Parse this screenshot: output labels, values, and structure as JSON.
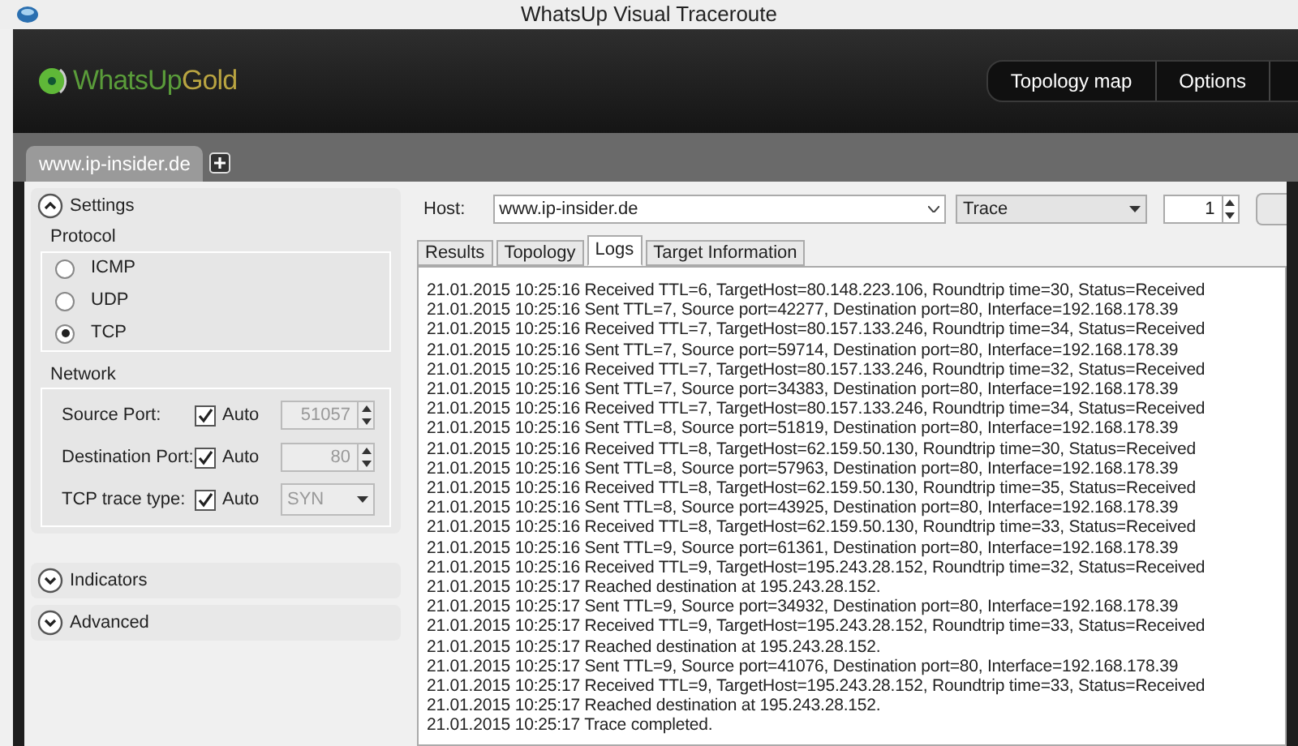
{
  "window": {
    "title": "WhatsUp Visual Traceroute"
  },
  "header": {
    "logo_first": "WhatsUp",
    "logo_second": "Gold",
    "nav": [
      {
        "label": "Topology map"
      },
      {
        "label": "Options"
      }
    ]
  },
  "document_tabs": [
    {
      "label": "www.ip-insider.de",
      "selected": true
    }
  ],
  "sidebar": {
    "sections": [
      {
        "title": "Settings",
        "expanded": true
      },
      {
        "title": "Indicators",
        "expanded": false
      },
      {
        "title": "Advanced",
        "expanded": false
      }
    ],
    "protocol": {
      "title": "Protocol",
      "options": [
        {
          "label": "ICMP",
          "selected": false
        },
        {
          "label": "UDP",
          "selected": false
        },
        {
          "label": "TCP",
          "selected": true
        }
      ]
    },
    "network": {
      "title": "Network",
      "rows": [
        {
          "label": "Source Port:",
          "auto_label": "Auto",
          "checked": true,
          "kind": "spinner",
          "value": "51057"
        },
        {
          "label": "Destination Port:",
          "auto_label": "Auto",
          "checked": true,
          "kind": "spinner",
          "value": "80"
        },
        {
          "label": "TCP trace type:",
          "auto_label": "Auto",
          "checked": true,
          "kind": "dropdown",
          "value": "SYN"
        }
      ]
    }
  },
  "toolbar": {
    "host_label": "Host:",
    "host": "www.ip-insider.de",
    "mode": "Trace",
    "count": "1"
  },
  "view_tabs": [
    {
      "label": "Results",
      "selected": false
    },
    {
      "label": "Topology",
      "selected": false
    },
    {
      "label": "Logs",
      "selected": true
    },
    {
      "label": "Target Information",
      "selected": false
    }
  ],
  "log": [
    "21.01.2015 10:25:16 Received TTL=6, TargetHost=80.148.223.106, Roundtrip time=30, Status=Received",
    "21.01.2015 10:25:16 Sent TTL=7, Source port=42277, Destination port=80, Interface=192.168.178.39",
    "21.01.2015 10:25:16 Received TTL=7, TargetHost=80.157.133.246, Roundtrip time=34, Status=Received",
    "21.01.2015 10:25:16 Sent TTL=7, Source port=59714, Destination port=80, Interface=192.168.178.39",
    "21.01.2015 10:25:16 Received TTL=7, TargetHost=80.157.133.246, Roundtrip time=32, Status=Received",
    "21.01.2015 10:25:16 Sent TTL=7, Source port=34383, Destination port=80, Interface=192.168.178.39",
    "21.01.2015 10:25:16 Received TTL=7, TargetHost=80.157.133.246, Roundtrip time=34, Status=Received",
    "21.01.2015 10:25:16 Sent TTL=8, Source port=51819, Destination port=80, Interface=192.168.178.39",
    "21.01.2015 10:25:16 Received TTL=8, TargetHost=62.159.50.130, Roundtrip time=30, Status=Received",
    "21.01.2015 10:25:16 Sent TTL=8, Source port=57963, Destination port=80, Interface=192.168.178.39",
    "21.01.2015 10:25:16 Received TTL=8, TargetHost=62.159.50.130, Roundtrip time=35, Status=Received",
    "21.01.2015 10:25:16 Sent TTL=8, Source port=43925, Destination port=80, Interface=192.168.178.39",
    "21.01.2015 10:25:16 Received TTL=8, TargetHost=62.159.50.130, Roundtrip time=33, Status=Received",
    "21.01.2015 10:25:16 Sent TTL=9, Source port=61361, Destination port=80, Interface=192.168.178.39",
    "21.01.2015 10:25:16 Received TTL=9, TargetHost=195.243.28.152, Roundtrip time=32, Status=Received",
    "21.01.2015 10:25:17 Reached destination at 195.243.28.152.",
    "21.01.2015 10:25:17 Sent TTL=9, Source port=34932, Destination port=80, Interface=192.168.178.39",
    "21.01.2015 10:25:17 Received TTL=9, TargetHost=195.243.28.152, Roundtrip time=33, Status=Received",
    "21.01.2015 10:25:17 Reached destination at 195.243.28.152.",
    "21.01.2015 10:25:17 Sent TTL=9, Source port=41076, Destination port=80, Interface=192.168.178.39",
    "21.01.2015 10:25:17 Received TTL=9, TargetHost=195.243.28.152, Roundtrip time=33, Status=Received",
    "21.01.2015 10:25:17 Reached destination at 195.243.28.152.",
    "21.01.2015 10:25:17 Trace completed."
  ]
}
